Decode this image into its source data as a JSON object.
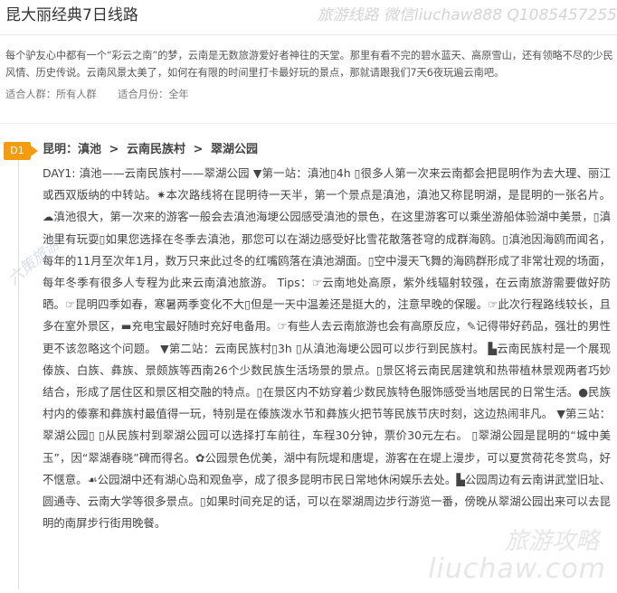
{
  "header": {
    "title": "昆大丽经典7日线路",
    "watermark": "旅游线路 微信liuchaw888 Q1085457255"
  },
  "intro": "每个驴友心中都有一个“彩云之南”的梦，云南是无数旅游爱好者神往的天堂。那里有看不完的碧水蓝天、高原雪山，还有领略不尽的少民风情、历史传说。云南风景太美了，如何在有限的时间里打卡最好玩的景点，那就请跟我们7天6夜玩遍云南吧。",
  "meta": {
    "crowd": "适合人群：所有人群",
    "month": "适合月份：全年"
  },
  "day1": {
    "badge": "D1",
    "route": [
      "昆明：滇池",
      "云南民族村",
      "翠湖公园"
    ],
    "route_sep": ">",
    "text": "DAY1: 滇池——云南民族村——翠湖公园 ▼第一站：滇池▯4h ▯很多人第一次来云南都会把昆明作为去大理、丽江或西双版纳的中转站。✷本次路线将在昆明待一天半，第一个景点是滇池，滇池又称昆明湖，是昆明的一张名片。☁滇池很大，第一次来的游客一般会去滇池海埂公园感受滇池的景色，在这里游客可以乘坐游船体验湖中美景，▯滇池里有玩耍▯如果您选择在冬季去滇池，那您可以在湖边感受好比雪花散落苍穹的成群海鸥。▯滇池因海鸥而闻名，每年的11月至次年1月，数万只来此过冬的红嘴鸥落在滇池湖面。▯空中漫天飞舞的海鸥群形成了非常壮观的场面，每年冬季有很多人专程为此来云南滇池旅游。 Tips：☞云南地处高原，紫外线辐射较强，在云南旅游需要做好防晒。☞昆明四季如春，寒暑两季变化不大▯但是一天中温差还是挺大的，注意早晚的保暖。☞此次行程路线较长，且多在室外景区，▬充电宝最好随时充好电备用。☞有些人去云南旅游也会有高原反应，✎记得带好药品，强壮的男性更不该忽略这个问题。 ▼第二站：云南民族村▯3h ▯从滇池海埂公园可以步行到民族村。 ▙云南民族村是一个展现傣族、白族、彝族、景颇族等西南26个少数民族生活场景的景点。▯景区将云南民居建筑和热带植林景观两者巧妙结合，形成了居住区和景区相交融的特点。▯在景区内不妨穿着少数民族特色服饰感受当地居民的日常生活。●民族村内的傣寨和彝族村最值得一玩，特别是在傣族泼水节和彝族火把节等民族节庆时刻，这边热闹非凡。 ▼第三站：翠湖公园▯ ▯从民族村到翠湖公园可以选择打车前往，车程30分钟，票价30元左右。 ▯翠湖公园是昆明的“城中美玉”，因“翠湖春晓”碑而得名。✿公园景色优美，湖中有阮堤和唐堤，游客在在堤上漫步，可以夏赏荷花冬赏鸟，好不惬意。☙公园湖中还有湖心岛和观鱼亭，成了很多昆明市民日常地休闲娱乐去处。▙公园周边有云南讲武堂旧址、圆通寺、云南大学等很多景点。▯如果时间充足的话，可以在翠湖周边步行游览一番，傍晚从翠湖公园出来可以去昆明的南屏步行街用晚餐。"
  },
  "watermarks": {
    "side": "六策旅游",
    "bottom1": "旅游攻略",
    "bottom2": "liuchaw.com"
  },
  "colors": {
    "badge": "#f39c12",
    "text": "#444444"
  }
}
